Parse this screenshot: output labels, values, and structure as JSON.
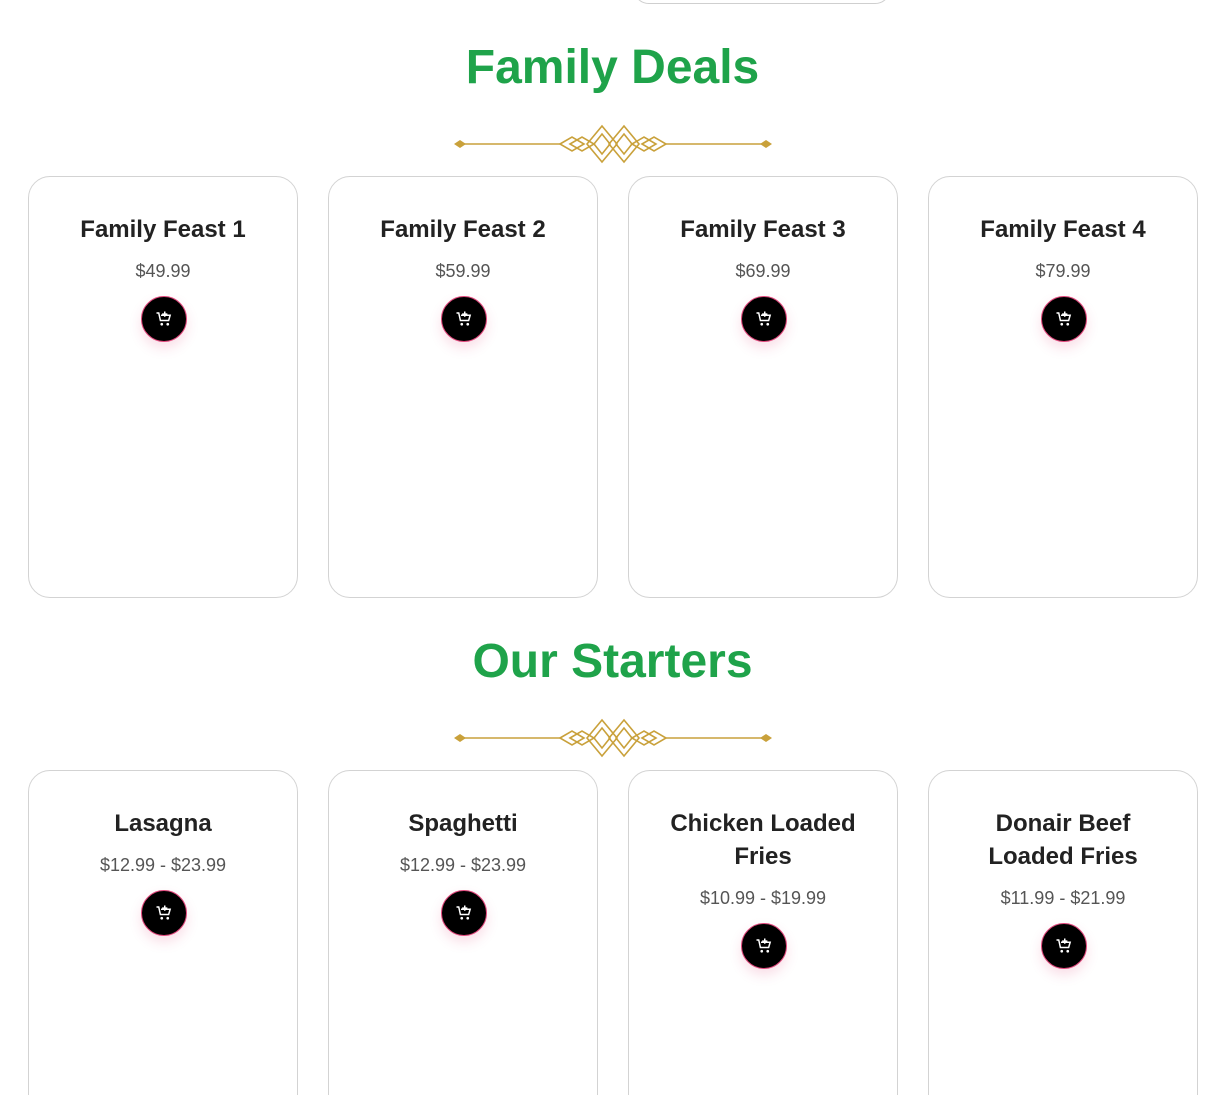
{
  "sections": [
    {
      "title": "Family Deals",
      "items": [
        {
          "name": "Family Feast 1",
          "price": "$49.99"
        },
        {
          "name": "Family Feast 2",
          "price": "$59.99"
        },
        {
          "name": "Family Feast 3",
          "price": "$69.99"
        },
        {
          "name": "Family Feast 4",
          "price": "$79.99"
        }
      ]
    },
    {
      "title": "Our Starters",
      "items": [
        {
          "name": "Lasagna",
          "price": "$12.99 - $23.99"
        },
        {
          "name": "Spaghetti",
          "price": "$12.99 - $23.99"
        },
        {
          "name": "Chicken Loaded Fries",
          "price": "$10.99 - $19.99"
        },
        {
          "name": "Donair Beef Loaded Fries",
          "price": "$11.99 - $21.99"
        }
      ]
    }
  ],
  "icons": {
    "cart": "add-to-cart-icon",
    "divider": "ornament-divider-icon"
  },
  "colors": {
    "heading": "#1fa34a",
    "ornament": "#c9a13b",
    "button_bg": "#000000",
    "button_ring": "#e0487c"
  }
}
